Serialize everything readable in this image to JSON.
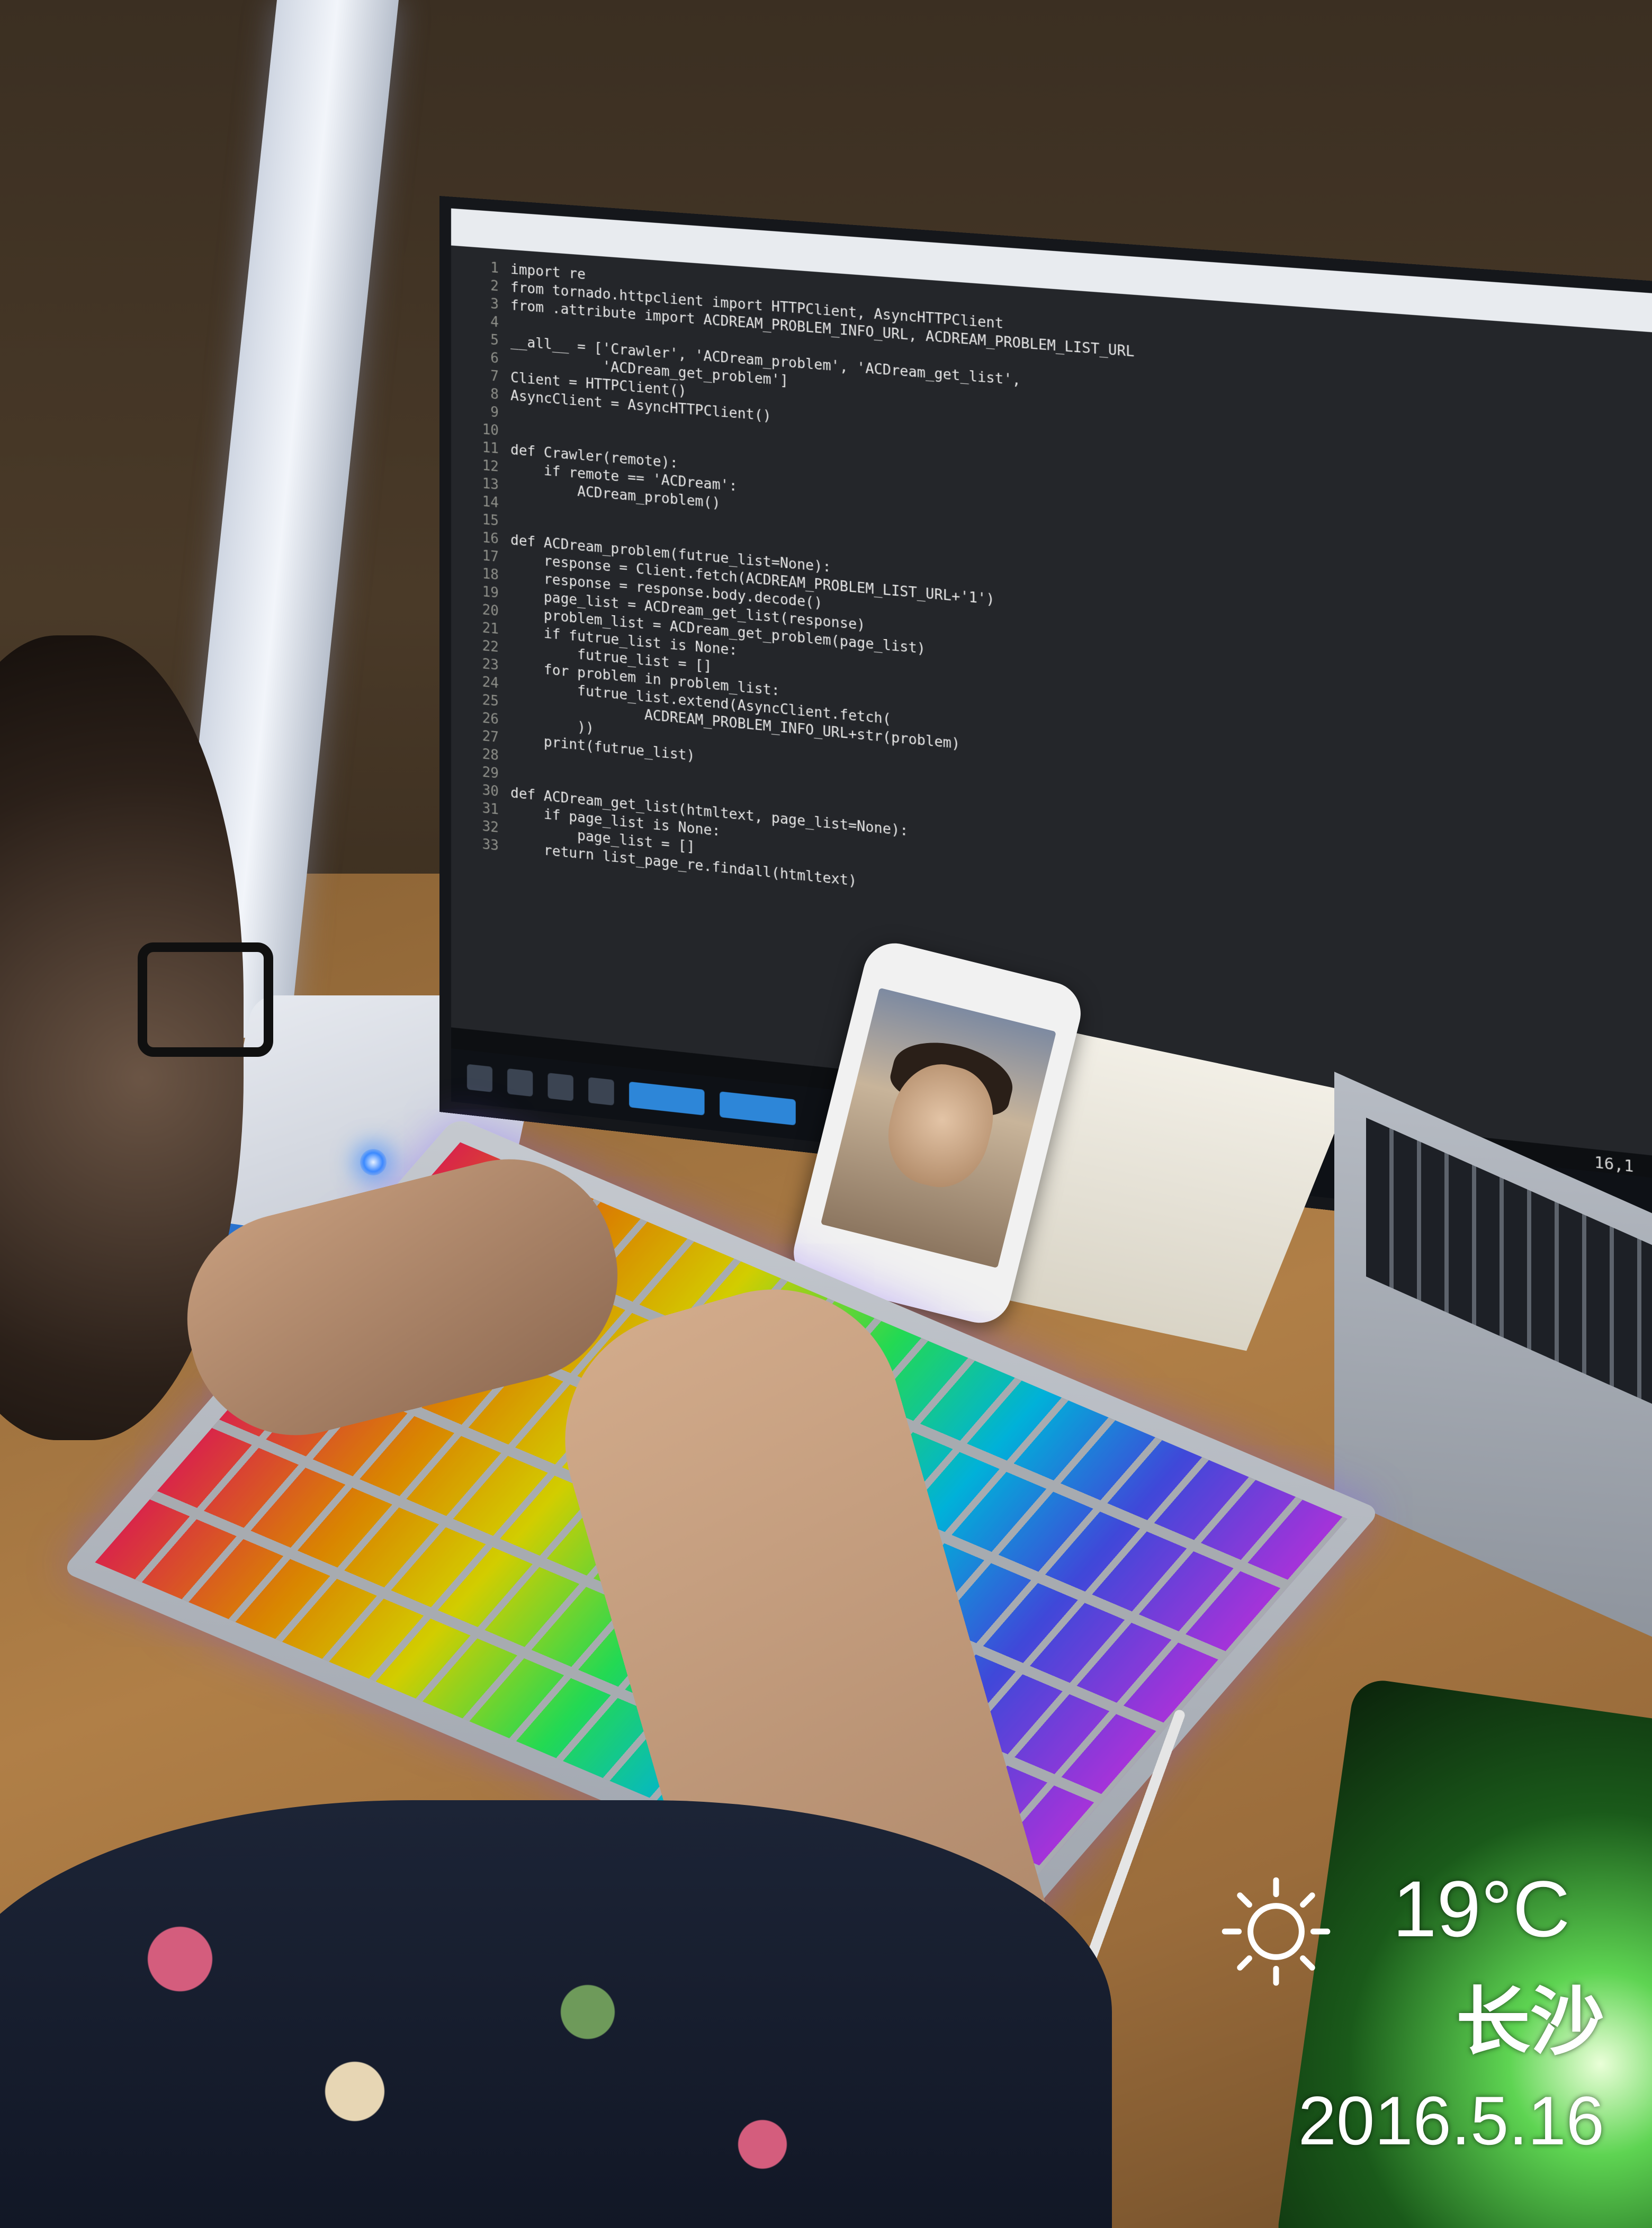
{
  "editor": {
    "lines": [
      {
        "n": "1",
        "text": "import re"
      },
      {
        "n": "2",
        "text": "from tornado.httpclient import HTTPClient, AsyncHTTPClient"
      },
      {
        "n": "3",
        "text": "from .attribute import ACDREAM_PROBLEM_INFO_URL, ACDREAM_PROBLEM_LIST_URL"
      },
      {
        "n": "4",
        "text": ""
      },
      {
        "n": "5",
        "text": "__all__ = ['Crawler', 'ACDream_problem', 'ACDream_get_list',"
      },
      {
        "n": "6",
        "text": "           'ACDream_get_problem']"
      },
      {
        "n": "7",
        "text": "Client = HTTPClient()"
      },
      {
        "n": "8",
        "text": "AsyncClient = AsyncHTTPClient()"
      },
      {
        "n": "9",
        "text": ""
      },
      {
        "n": "10",
        "text": ""
      },
      {
        "n": "11",
        "text": "def Crawler(remote):"
      },
      {
        "n": "12",
        "text": "    if remote == 'ACDream':"
      },
      {
        "n": "13",
        "text": "        ACDream_problem()"
      },
      {
        "n": "14",
        "text": ""
      },
      {
        "n": "15",
        "text": ""
      },
      {
        "n": "16",
        "text": "def ACDream_problem(futrue_list=None):"
      },
      {
        "n": "17",
        "text": "    response = Client.fetch(ACDREAM_PROBLEM_LIST_URL+'1')"
      },
      {
        "n": "18",
        "text": "    response = response.body.decode()"
      },
      {
        "n": "19",
        "text": "    page_list = ACDream_get_list(response)"
      },
      {
        "n": "20",
        "text": "    problem_list = ACDream_get_problem(page_list)"
      },
      {
        "n": "21",
        "text": "    if futrue_list is None:"
      },
      {
        "n": "22",
        "text": "        futrue_list = []"
      },
      {
        "n": "23",
        "text": "    for problem in problem_list:"
      },
      {
        "n": "24",
        "text": "        futrue_list.extend(AsyncClient.fetch("
      },
      {
        "n": "25",
        "text": "                ACDREAM_PROBLEM_INFO_URL+str(problem)"
      },
      {
        "n": "26",
        "text": "        ))"
      },
      {
        "n": "27",
        "text": "    print(futrue_list)"
      },
      {
        "n": "28",
        "text": ""
      },
      {
        "n": "29",
        "text": ""
      },
      {
        "n": "30",
        "text": "def ACDream_get_list(htmltext, page_list=None):"
      },
      {
        "n": "31",
        "text": "    if page_list is None:"
      },
      {
        "n": "32",
        "text": "        page_list = []"
      },
      {
        "n": "33",
        "text": "    return list_page_re.findall(htmltext)"
      }
    ],
    "cursor_position": "16,1"
  },
  "watermark": {
    "weather_icon": "sun-icon",
    "temperature": "19°C",
    "city": "长沙",
    "date": "2016.5.16"
  },
  "colors": {
    "editor_bg": "#24262a",
    "keyword": "#f92672",
    "function": "#a6e22e",
    "string": "#e6db74",
    "lamp_led": "#3b8bff"
  }
}
